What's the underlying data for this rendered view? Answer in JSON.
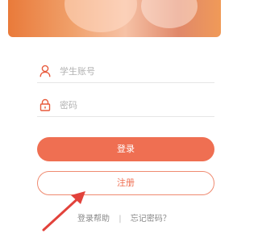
{
  "form": {
    "username_placeholder": "学生账号",
    "password_placeholder": "密码",
    "username_icon": "user-icon",
    "password_icon": "lock-icon"
  },
  "buttons": {
    "login_label": "登录",
    "register_label": "注册"
  },
  "links": {
    "help_label": "登录帮助",
    "separator": "|",
    "forgot_label": "忘记密码？"
  },
  "colors": {
    "accent": "#ef6f52",
    "annotation_arrow": "#e2423b"
  }
}
